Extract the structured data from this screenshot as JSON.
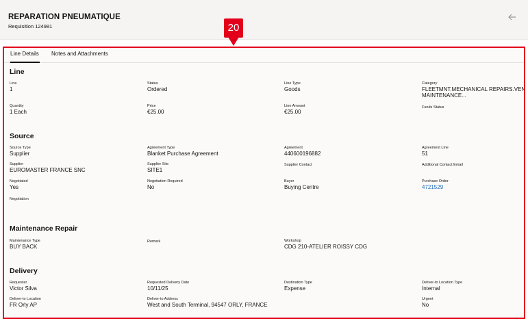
{
  "header": {
    "title": "REPARATION PNEUMATIQUE",
    "subtitle": "Requisition 124981"
  },
  "callout": {
    "number": "20"
  },
  "tabs": [
    {
      "label": "Line Details",
      "active": true
    },
    {
      "label": "Notes and Attachments",
      "active": false
    }
  ],
  "line": {
    "heading": "Line",
    "line_label": "Line",
    "line_value": "1",
    "status_label": "Status",
    "status_value": "Ordered",
    "line_type_label": "Line Type",
    "line_type_value": "Goods",
    "category_label": "Category",
    "category_value_1": "FLEETMNT.MECHANICAL REPAIRS.VENDED",
    "category_value_2": "MAINTENANCE...",
    "quantity_label": "Quantity",
    "quantity_value": "1 Each",
    "price_label": "Price",
    "price_value": "€25.00",
    "line_amount_label": "Line Amount",
    "line_amount_value": "€25.00",
    "funds_status_label": "Funds Status"
  },
  "source": {
    "heading": "Source",
    "source_type_label": "Source Type",
    "source_type_value": "Supplier",
    "agreement_type_label": "Agreement Type",
    "agreement_type_value": "Blanket Purchase Agreement",
    "agreement_label": "Agreement",
    "agreement_value": "440600196882",
    "agreement_line_label": "Agreement Line",
    "agreement_line_value": "51",
    "supplier_label": "Supplier",
    "supplier_value": "EUROMASTER FRANCE SNC",
    "supplier_site_label": "Supplier Site",
    "supplier_site_value": "SITE1",
    "supplier_contact_label": "Supplier Contact",
    "additional_contact_label": "Additional Contact Email",
    "negotiated_label": "Negotiated",
    "negotiated_value": "Yes",
    "negotiation_required_label": "Negotiation Required",
    "negotiation_required_value": "No",
    "buyer_label": "Buyer",
    "buyer_value": "Buying Centre",
    "purchase_order_label": "Purchase Order",
    "purchase_order_value": "4721529",
    "negotiation_label": "Negotiation"
  },
  "maintenance": {
    "heading": "Maintenance Repair",
    "maintenance_type_label": "Maintenance Type",
    "maintenance_type_value": "BUY BACK",
    "remark_label": "Remark",
    "workshop_label": "Workshop",
    "workshop_value": "CDG 210-ATELIER ROISSY CDG"
  },
  "delivery": {
    "heading": "Delivery",
    "requester_label": "Requester",
    "requester_value": "Victor Silva",
    "requested_date_label": "Requested Delivery Date",
    "requested_date_value": "10/11/25",
    "destination_type_label": "Destination Type",
    "destination_type_value": "Expense",
    "deliver_to_location_type_label": "Deliver-to Location Type",
    "deliver_to_location_type_value": "Internal",
    "deliver_to_location_label": "Deliver-to Location",
    "deliver_to_location_value": "FR Orly AP",
    "deliver_to_address_label": "Deliver-to Address",
    "deliver_to_address_value": "West and South Terminal, 94547 ORLY, FRANCE",
    "urgent_label": "Urgent",
    "urgent_value": "No"
  },
  "colors": {
    "highlight": "#e2001a",
    "link": "#1d6fb8",
    "header_bg": "#f5f4f2"
  },
  "icons": {
    "back": "arrow-left-icon"
  }
}
